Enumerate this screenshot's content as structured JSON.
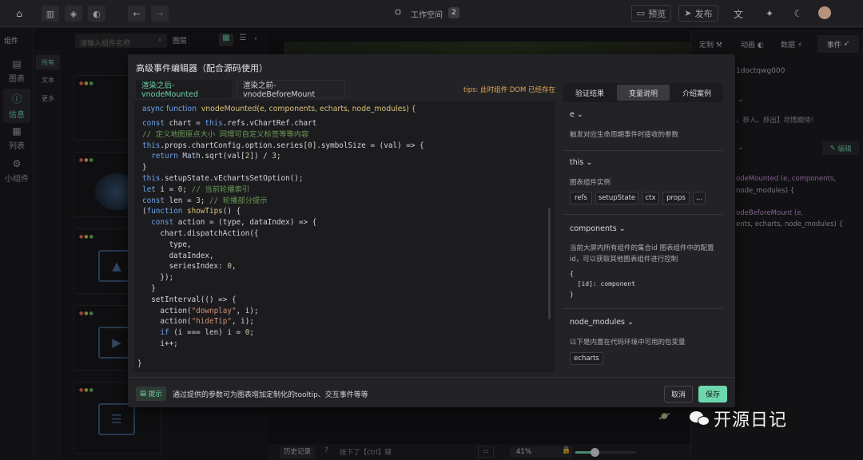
{
  "topbar": {
    "workspace_label": "工作空间",
    "workspace_count": "2",
    "preview_label": "预览",
    "publish_label": "发布"
  },
  "leftbar": {
    "components_label": "组件",
    "nav": [
      {
        "label": "图表"
      },
      {
        "label": "信息"
      },
      {
        "label": "列表"
      },
      {
        "label": "小组件"
      }
    ],
    "subnav": [
      "所有",
      "文本",
      "更多"
    ],
    "search_placeholder": "请输入组件名称",
    "layers_label": "图层"
  },
  "right_behind": {
    "tabs": [
      "定制",
      "动画",
      "数据",
      "事件"
    ],
    "id_text": "1doctqwg000",
    "hint_text": "、移入、移出】尽情期待!",
    "edit_label": "编辑",
    "line1": "odeMounted (e, components,",
    "line2": "node_modules) {",
    "line3": "odeBeforeMount (e,",
    "line4": "ents, echarts, node_modules) {"
  },
  "dialog": {
    "title": "高级事件编辑器（配合源码使用）",
    "tab_active": "渲染之后-vnodeMounted",
    "tab_inactive": "渲染之前-vnodeBeforeMount",
    "tips": "tips: 此时组件 DOM 已经存在",
    "fn_async": "async function",
    "fn_name": "vnodeMounted(e, components, echarts, node_modules) {",
    "code_end": "}",
    "right_tabs": [
      "验证结果",
      "变量说明",
      "介绍案例"
    ],
    "sections": {
      "e_title": "e",
      "e_desc": "触发对应生命周期事件时接收的参数",
      "this_title": "this",
      "this_desc": "图表组件实例",
      "this_chips": [
        "refs",
        "setupState",
        "ctx",
        "props",
        "..."
      ],
      "components_title": "components",
      "components_desc": "当前大屏内所有组件的集合id 图表组件中的配置id，可以获取其他图表组件进行控制",
      "components_code1": "{",
      "components_code2": "  [id]: component",
      "components_code3": "}",
      "node_modules_title": "node_modules",
      "node_modules_desc": "以下是内置在代码环境中可用的包变量",
      "node_chip": "echarts"
    },
    "footer": {
      "hint_tag": "提示",
      "hint_text": "通过提供的参数可为图表增加定制化的tooltip、交互事件等等",
      "cancel_label": "取消",
      "save_label": "保存"
    }
  },
  "bottombar": {
    "history_label": "历史记录",
    "shortcut_hint": "按下了【ctrl】键",
    "zoom": "41%"
  },
  "watermark": "开源日记",
  "colors": {
    "accent": "#5fd3a9",
    "save_bg": "#6dd7ad",
    "tab_active_text": "#6fd3a8",
    "tips": "#e0a653"
  }
}
